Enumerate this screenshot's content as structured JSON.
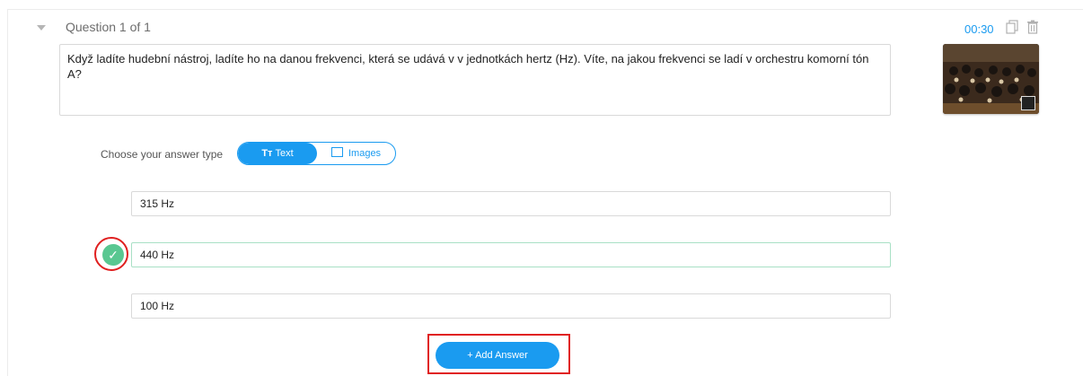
{
  "question": {
    "counter": "Question 1 of 1",
    "text": "Když ladíte hudební nástroj, ladíte ho na danou frekvenci, která se udává v v jednotkách hertz (Hz). Víte, na jakou frekvenci se ladí v orchestru komorní tón A?",
    "timer": "00:30",
    "image_alt": "orchestra photo"
  },
  "answer_type": {
    "label": "Choose your answer type",
    "text_option": "Text",
    "images_option": "Images",
    "selected": "Text"
  },
  "answers": [
    {
      "text": "315 Hz",
      "correct": false
    },
    {
      "text": "440 Hz",
      "correct": true
    },
    {
      "text": "100 Hz",
      "correct": false
    }
  ],
  "add_answer_label": "+ Add Answer",
  "colors": {
    "accent": "#1a9bf0",
    "correct": "#59c791",
    "highlight": "#e02020"
  },
  "icons": [
    "chevron-down-icon",
    "copy-icon",
    "trash-icon",
    "text-type-icon",
    "image-icon",
    "check-icon"
  ]
}
